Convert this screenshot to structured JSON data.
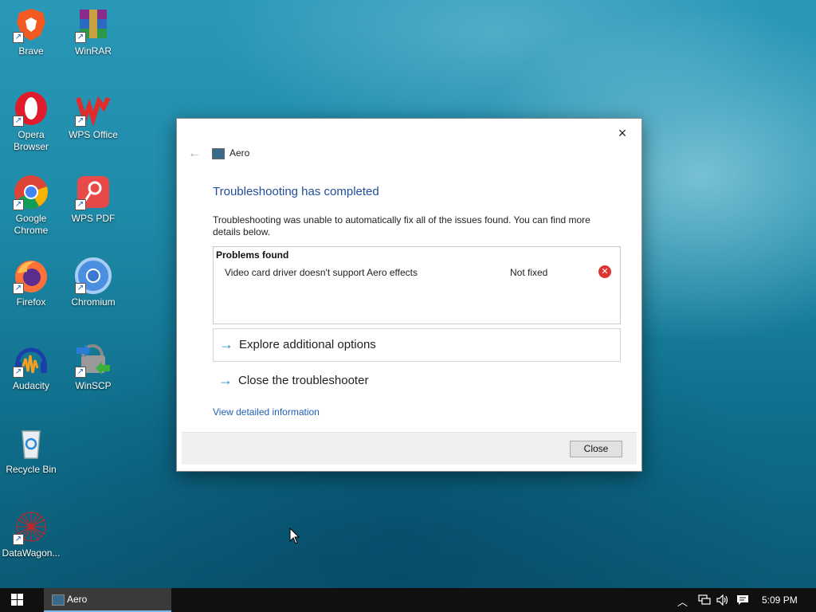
{
  "desktop": {
    "icons": [
      {
        "label": "Brave"
      },
      {
        "label": "WinRAR"
      },
      {
        "label": "Opera Browser"
      },
      {
        "label": "WPS Office"
      },
      {
        "label": "Google Chrome"
      },
      {
        "label": "WPS PDF"
      },
      {
        "label": "Firefox"
      },
      {
        "label": "Chromium"
      },
      {
        "label": "Audacity"
      },
      {
        "label": "WinSCP"
      },
      {
        "label": "Recycle Bin"
      },
      {
        "label": "DataWagon..."
      }
    ]
  },
  "dialog": {
    "title": "Aero",
    "close_icon": "×",
    "back_icon": "←",
    "heading": "Troubleshooting has completed",
    "description": "Troubleshooting was unable to automatically fix all of the issues found. You can find more details below.",
    "problems": {
      "title": "Problems found",
      "items": [
        {
          "text": "Video card driver doesn't support Aero effects",
          "status": "Not fixed",
          "icon": "error-icon"
        }
      ]
    },
    "options": [
      {
        "label": "Explore additional options"
      },
      {
        "label": "Close the troubleshooter"
      }
    ],
    "detail_link": "View detailed information",
    "close_button": "Close"
  },
  "taskbar": {
    "active_item": "Aero",
    "clock": "5:09 PM",
    "colors": {
      "background": "#101010",
      "accent": "#7ab5e8"
    }
  }
}
